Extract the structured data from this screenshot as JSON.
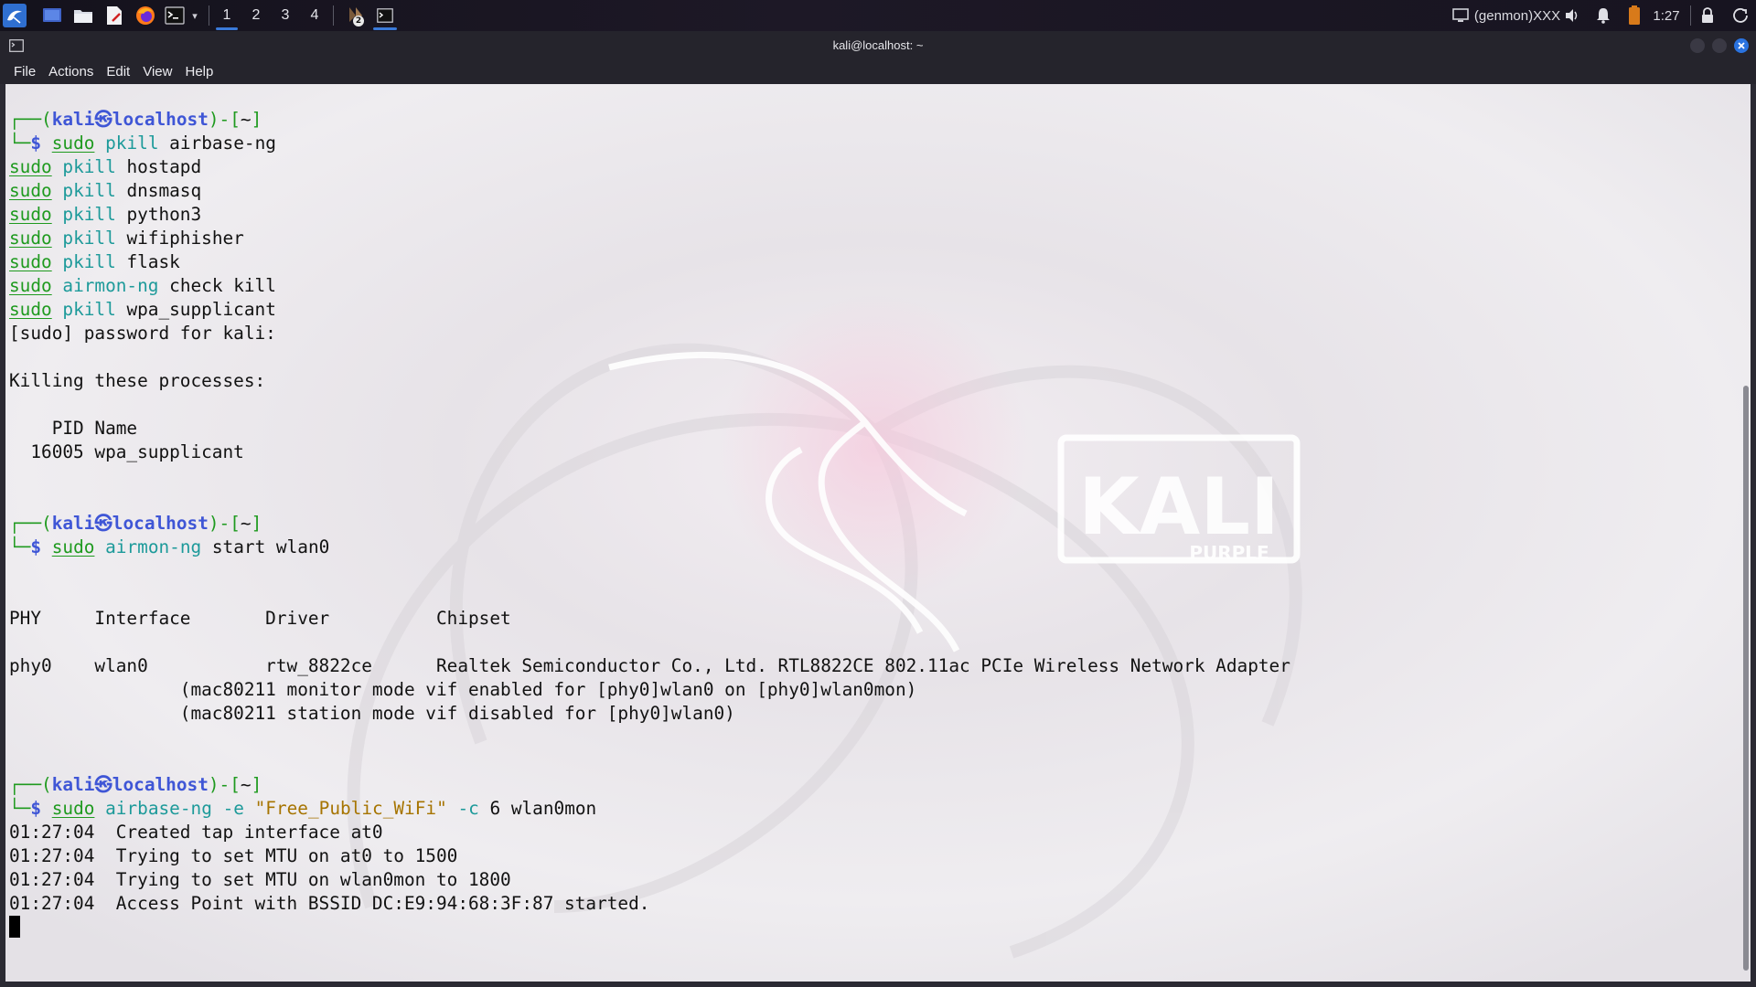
{
  "panel": {
    "workspaces": [
      "1",
      "2",
      "3",
      "4"
    ],
    "badge": "2",
    "genmon": "(genmon)XXX",
    "clock": "1:27"
  },
  "window": {
    "title": "kali@localhost: ~",
    "menu": [
      "File",
      "Actions",
      "Edit",
      "View",
      "Help"
    ]
  },
  "wallpaper": {
    "logo": "KALI",
    "sublogo": "PURPLE"
  },
  "terminal": {
    "prompt": {
      "open": "┌──(",
      "user": "kali",
      "at": "㉿",
      "host": "localhost",
      "close": ")-[",
      "dir": "~",
      "end": "]",
      "line2": "└─",
      "dollar": "$"
    },
    "lines": [
      {
        "kind": "blank"
      },
      {
        "kind": "prompt"
      },
      {
        "kind": "cmd",
        "parts": [
          [
            "gu",
            "sudo"
          ],
          [
            "t",
            " "
          ],
          [
            "c",
            "pkill"
          ],
          [
            "t",
            " airbase-ng"
          ]
        ]
      },
      {
        "kind": "raw",
        "parts": [
          [
            "gu",
            "sudo"
          ],
          [
            "t",
            " "
          ],
          [
            "c",
            "pkill"
          ],
          [
            "t",
            " hostapd"
          ]
        ]
      },
      {
        "kind": "raw",
        "parts": [
          [
            "gu",
            "sudo"
          ],
          [
            "t",
            " "
          ],
          [
            "c",
            "pkill"
          ],
          [
            "t",
            " dnsmasq"
          ]
        ]
      },
      {
        "kind": "raw",
        "parts": [
          [
            "gu",
            "sudo"
          ],
          [
            "t",
            " "
          ],
          [
            "c",
            "pkill"
          ],
          [
            "t",
            " python3"
          ]
        ]
      },
      {
        "kind": "raw",
        "parts": [
          [
            "gu",
            "sudo"
          ],
          [
            "t",
            " "
          ],
          [
            "c",
            "pkill"
          ],
          [
            "t",
            " wifiphisher"
          ]
        ]
      },
      {
        "kind": "raw",
        "parts": [
          [
            "gu",
            "sudo"
          ],
          [
            "t",
            " "
          ],
          [
            "c",
            "pkill"
          ],
          [
            "t",
            " flask"
          ]
        ]
      },
      {
        "kind": "raw",
        "parts": [
          [
            "gu",
            "sudo"
          ],
          [
            "t",
            " "
          ],
          [
            "c",
            "airmon-ng"
          ],
          [
            "t",
            " check kill"
          ]
        ]
      },
      {
        "kind": "raw",
        "parts": [
          [
            "gu",
            "sudo"
          ],
          [
            "t",
            " "
          ],
          [
            "c",
            "pkill"
          ],
          [
            "t",
            " wpa_supplicant"
          ]
        ]
      },
      {
        "kind": "raw",
        "parts": [
          [
            "t",
            "[sudo] password for kali:"
          ]
        ]
      },
      {
        "kind": "blank"
      },
      {
        "kind": "raw",
        "parts": [
          [
            "t",
            "Killing these processes:"
          ]
        ]
      },
      {
        "kind": "blank"
      },
      {
        "kind": "raw",
        "parts": [
          [
            "t",
            "    PID Name"
          ]
        ]
      },
      {
        "kind": "raw",
        "parts": [
          [
            "t",
            "  16005 wpa_supplicant"
          ]
        ]
      },
      {
        "kind": "blank"
      },
      {
        "kind": "blank"
      },
      {
        "kind": "prompt"
      },
      {
        "kind": "cmd",
        "parts": [
          [
            "gu",
            "sudo"
          ],
          [
            "t",
            " "
          ],
          [
            "c",
            "airmon-ng"
          ],
          [
            "t",
            " start wlan0"
          ]
        ]
      },
      {
        "kind": "blank"
      },
      {
        "kind": "blank"
      },
      {
        "kind": "raw",
        "parts": [
          [
            "t",
            "PHY\tInterface\tDriver\t\tChipset"
          ]
        ]
      },
      {
        "kind": "blank"
      },
      {
        "kind": "raw",
        "parts": [
          [
            "t",
            "phy0\twlan0\t\trtw_8822ce\tRealtek Semiconductor Co., Ltd. RTL8822CE 802.11ac PCIe Wireless Network Adapter"
          ]
        ]
      },
      {
        "kind": "raw",
        "parts": [
          [
            "t",
            "\t\t(mac80211 monitor mode vif enabled for [phy0]wlan0 on [phy0]wlan0mon)"
          ]
        ]
      },
      {
        "kind": "raw",
        "parts": [
          [
            "t",
            "\t\t(mac80211 station mode vif disabled for [phy0]wlan0)"
          ]
        ]
      },
      {
        "kind": "blank"
      },
      {
        "kind": "blank"
      },
      {
        "kind": "prompt"
      },
      {
        "kind": "cmd",
        "parts": [
          [
            "gu",
            "sudo"
          ],
          [
            "t",
            " "
          ],
          [
            "c",
            "airbase-ng"
          ],
          [
            "t",
            " "
          ],
          [
            "c",
            "-e"
          ],
          [
            "t",
            " "
          ],
          [
            "s",
            "\"Free_Public_WiFi\""
          ],
          [
            "t",
            " "
          ],
          [
            "c",
            "-c"
          ],
          [
            "t",
            " 6 wlan0mon"
          ]
        ]
      },
      {
        "kind": "raw",
        "parts": [
          [
            "t",
            "01:27:04  Created tap interface at0"
          ]
        ]
      },
      {
        "kind": "raw",
        "parts": [
          [
            "t",
            "01:27:04  Trying to set MTU on at0 to 1500"
          ]
        ]
      },
      {
        "kind": "raw",
        "parts": [
          [
            "t",
            "01:27:04  Trying to set MTU on wlan0mon to 1800"
          ]
        ]
      },
      {
        "kind": "raw",
        "parts": [
          [
            "t",
            "01:27:04  Access Point with BSSID DC:E9:94:68:3F:87 started."
          ]
        ]
      },
      {
        "kind": "cursor"
      }
    ]
  },
  "colors": {
    "prompt_frame": "#1f9a1f",
    "prompt_user": "#3f56d6",
    "command": "#1d9a9a",
    "sudo": "#1f9a1f",
    "string": "#a67400",
    "workspace_active": "#3a7ad8"
  }
}
